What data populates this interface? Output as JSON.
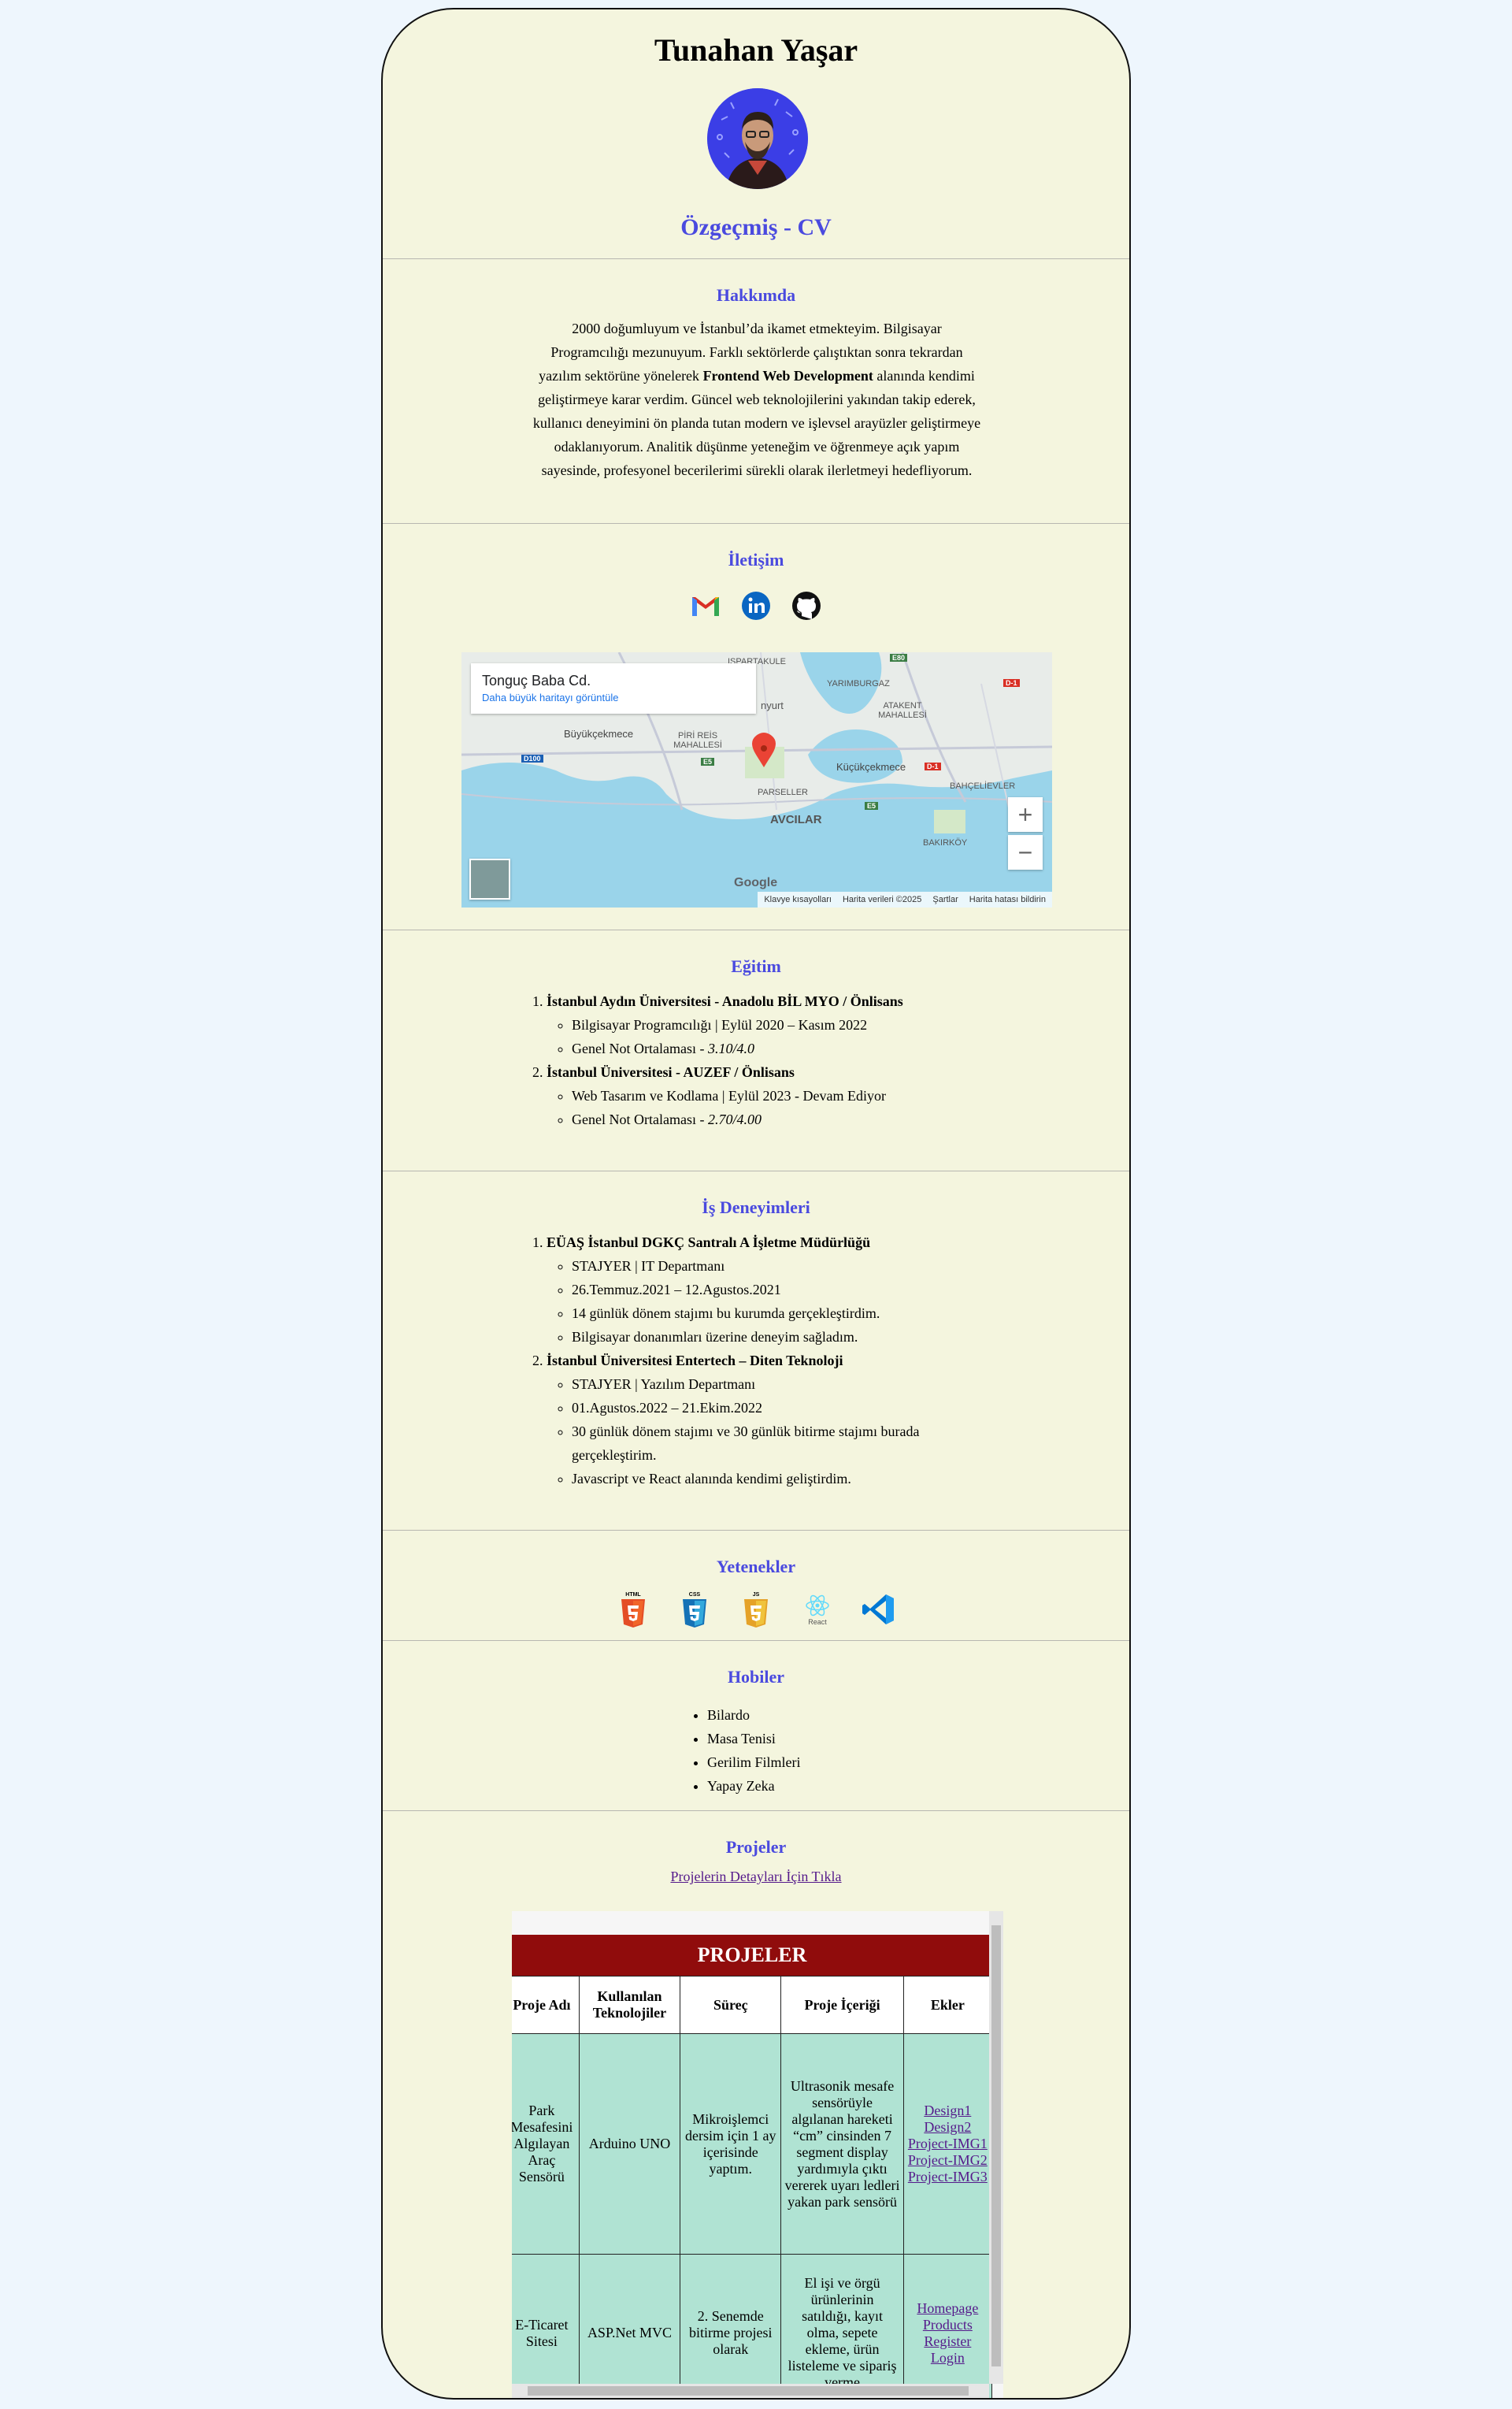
{
  "header": {
    "name": "Tunahan Yaşar",
    "cv_title": "Özgeçmiş - CV"
  },
  "about": {
    "title": "Hakkımda",
    "text_before": "2000 doğumluyum ve İstanbul’da ikamet etmekteyim. Bilgisayar Programcılığı mezunuyum. Farklı sektörlerde çalıştıktan sonra tekrardan yazılım sektörüne yönelerek ",
    "text_bold": "Frontend Web Development",
    "text_after": " alanında kendimi geliştirmeye karar verdim. Güncel web teknolojilerini yakından takip ederek, kullanıcı deneyimini ön planda tutan modern ve işlevsel arayüzler geliştirmeye odaklanıyorum. Analitik düşünme yeteneğim ve öğrenmeye açık yapım sayesinde, profesyonel becerilerimi sürekli olarak ilerletmeyi hedefliyorum."
  },
  "contact": {
    "title": "İletişim",
    "icons": [
      "gmail-icon",
      "linkedin-icon",
      "github-icon"
    ],
    "map": {
      "place": "Tonguç Baba Cd.",
      "larger_map": "Daha büyük haritayı görüntüle",
      "labels": [
        "ISPARTAKULE",
        "YARIMBURGAZ",
        "ATAKENT MAHALLESİ",
        "Büyükçekmece",
        "PİRİ REİS MAHALLESİ",
        "Küçükçekmece",
        "PARSELLER",
        "AVCILAR",
        "BAHÇELİEVLER",
        "BAKIRKÖY",
        "nyurt"
      ],
      "road_labels": [
        "E80",
        "D-1",
        "D100",
        "E5",
        "D-1",
        "E5"
      ],
      "zoom_in": "+",
      "zoom_out": "−",
      "google": "Google",
      "footer": [
        "Klavye kısayolları",
        "Harita verileri ©2025",
        "Şartlar",
        "Harita hatası bildirin"
      ]
    }
  },
  "education": {
    "title": "Eğitim",
    "items": [
      {
        "head": "İstanbul Aydın Üniversitesi - Anadolu BİL MYO / Önlisans",
        "line1": "Bilgisayar Programcılığı | Eylül 2020 – Kasım 2022",
        "gpa_label": "Genel Not Ortalaması - ",
        "gpa": "3.10/4.0"
      },
      {
        "head": "İstanbul Üniversitesi - AUZEF / Önlisans",
        "line1": "Web Tasarım ve Kodlama | Eylül 2023 - Devam Ediyor",
        "gpa_label": "Genel Not Ortalaması - ",
        "gpa": "2.70/4.00"
      }
    ]
  },
  "experience": {
    "title": "İş Deneyimleri",
    "items": [
      {
        "head": "EÜAŞ İstanbul DGKÇ Santralı A İşletme Müdürlüğü",
        "bullets": [
          "STAJYER | IT Departmanı",
          "26.Temmuz.2021 – 12.Agustos.2021",
          "14 günlük dönem stajımı bu kurumda gerçekleştirdim.",
          "Bilgisayar donanımları üzerine deneyim sağladım."
        ]
      },
      {
        "head": "İstanbul Üniversitesi Entertech – Diten Teknoloji",
        "bullets": [
          "STAJYER | Yazılım Departmanı",
          "01.Agustos.2022 – 21.Ekim.2022",
          "30 günlük dönem stajımı ve 30 günlük bitirme stajımı burada gerçekleştirim.",
          "Javascript ve React alanında kendimi geliştirdim."
        ]
      }
    ]
  },
  "skills": {
    "title": "Yetenekler",
    "icons": [
      "html5-icon",
      "css3-icon",
      "javascript-icon",
      "react-icon",
      "vscode-icon"
    ],
    "html": "HTML",
    "css": "CSS",
    "js": "JS",
    "react": "React"
  },
  "hobbies": {
    "title": "Hobiler",
    "items": [
      "Bilardo",
      "Masa Tenisi",
      "Gerilim Filmleri",
      "Yapay Zeka"
    ]
  },
  "projects": {
    "title": "Projeler",
    "link": "Projelerin Detayları İçin Tıkla",
    "banner": "PROJELER",
    "columns": [
      "Proje Adı",
      "Kullanılan Teknolojiler",
      "Süreç",
      "Proje İçeriği",
      "Ekler"
    ],
    "rows": [
      {
        "name": "Park Mesafesini Algılayan Araç Sensörü",
        "tech": "Arduino UNO",
        "process": "Mikroişlemci dersim için 1 ay içerisinde yaptım.",
        "content": "Ultrasonik mesafe sensörüyle algılanan hareketi “cm” cinsinden 7 segment display yardımıyla çıktı vererek uyarı ledleri yakan park sensörü",
        "attachments": [
          "Design1",
          "Design2",
          "Project-IMG1",
          "Project-IMG2",
          "Project-IMG3"
        ]
      },
      {
        "name": "E-Ticaret Sitesi",
        "tech": "ASP.Net MVC",
        "process": "2. Senemde bitirme projesi olarak",
        "content": "El işi ve örgü ürünlerinin satıldığı, kayıt olma, sepete ekleme, ürün listeleme ve sipariş verme",
        "attachments": [
          "Homepage",
          "Products",
          "Register",
          "Login"
        ]
      }
    ]
  }
}
